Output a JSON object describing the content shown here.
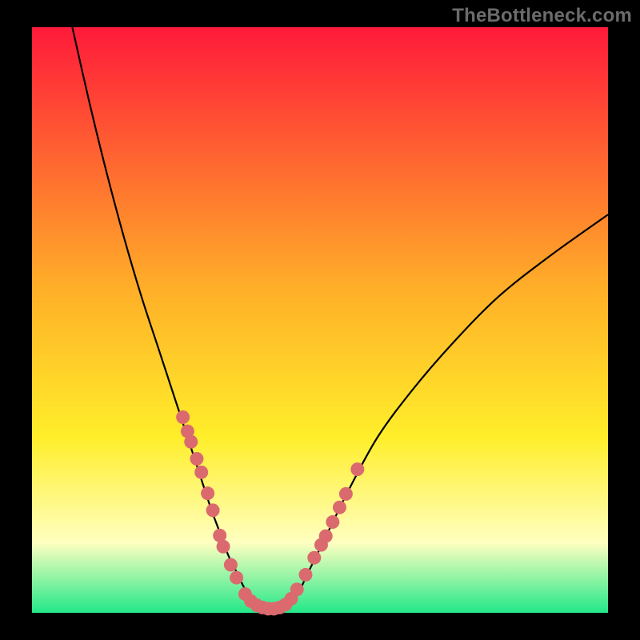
{
  "watermark": "TheBottleneck.com",
  "colors": {
    "frame": "#000000",
    "gradient_top": "#ff1a3a",
    "gradient_mid1": "#ffb028",
    "gradient_mid2": "#ffee2a",
    "gradient_pale": "#ffffc0",
    "gradient_bottom": "#23e889",
    "curve": "#000000",
    "dot": "#db6a6f"
  },
  "chart_data": {
    "type": "line",
    "title": "",
    "xlabel": "",
    "ylabel": "",
    "xlim": [
      0,
      100
    ],
    "ylim": [
      0,
      100
    ],
    "series": [
      {
        "name": "bottleneck-curve",
        "x": [
          7,
          10,
          13,
          16,
          19,
          22,
          25,
          27,
          29,
          31,
          32.5,
          34,
          35.5,
          37,
          38.5,
          40,
          42,
          44,
          46,
          48,
          51,
          55,
          60,
          66,
          73,
          81,
          90,
          100
        ],
        "y": [
          100,
          87,
          75,
          64,
          54,
          45,
          36,
          30,
          24,
          18,
          14,
          10,
          7,
          4,
          2,
          1,
          0.5,
          1,
          3,
          7,
          13,
          21,
          30,
          38,
          46,
          54,
          61,
          68
        ]
      }
    ],
    "dots_series": {
      "name": "highlight-dots",
      "x": [
        26.2,
        27.0,
        27.6,
        28.6,
        29.4,
        30.5,
        31.4,
        32.6,
        33.2,
        34.5,
        35.5,
        37.0,
        38.0,
        39.0,
        40.0,
        41.0,
        42.0,
        43.0,
        44.0,
        45.0,
        46.0,
        47.5,
        49.0,
        50.2,
        51.0,
        52.2,
        53.4,
        54.5,
        56.5
      ],
      "y": [
        33.4,
        31.0,
        29.2,
        26.3,
        24.0,
        20.4,
        17.5,
        13.2,
        11.3,
        8.2,
        6.0,
        3.2,
        2.0,
        1.3,
        0.9,
        0.7,
        0.7,
        0.9,
        1.4,
        2.4,
        4.0,
        6.5,
        9.4,
        11.6,
        13.1,
        15.5,
        18.0,
        20.3,
        24.5
      ]
    }
  }
}
